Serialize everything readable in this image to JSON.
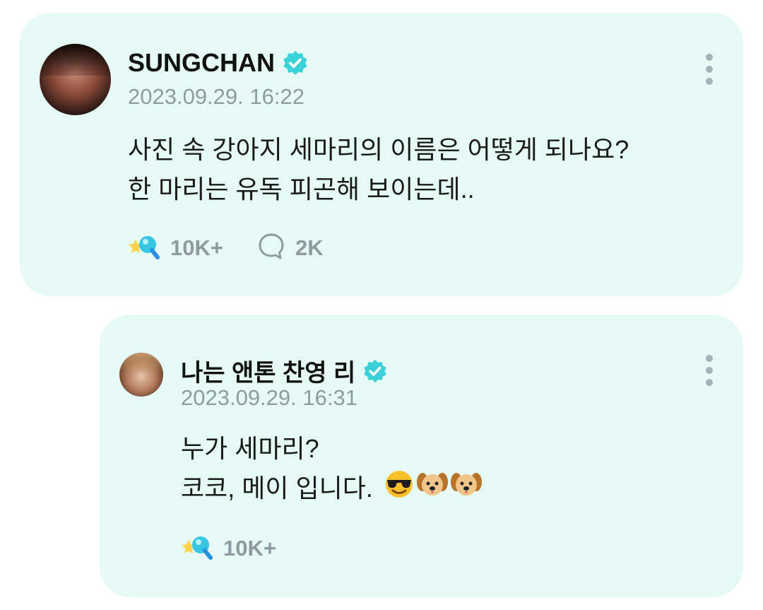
{
  "post": {
    "author": "SUNGCHAN",
    "date": "2023.09.29. 16:22",
    "lines": [
      "사진 속 강아지 세마리의 이름은 어떻게 되나요?",
      "한 마리는 유독 피곤해 보이는데.."
    ],
    "likes": "10K+",
    "comments": "2K"
  },
  "reply": {
    "author": "나는 앤톤 찬영 리",
    "date": "2023.09.29. 16:31",
    "lines": [
      "누가 세마리?",
      "코코, 메이 입니다."
    ],
    "likes": "10K+"
  },
  "colors": {
    "card_bg": "#e5faf5",
    "verified": "#3ad1d9",
    "muted": "#8e9aa0"
  },
  "icons": [
    "verified-badge-icon",
    "more-options-icon",
    "wand-like-icon",
    "comment-bubble-icon",
    "sunglasses-face-emoji",
    "dog-face-emoji"
  ]
}
